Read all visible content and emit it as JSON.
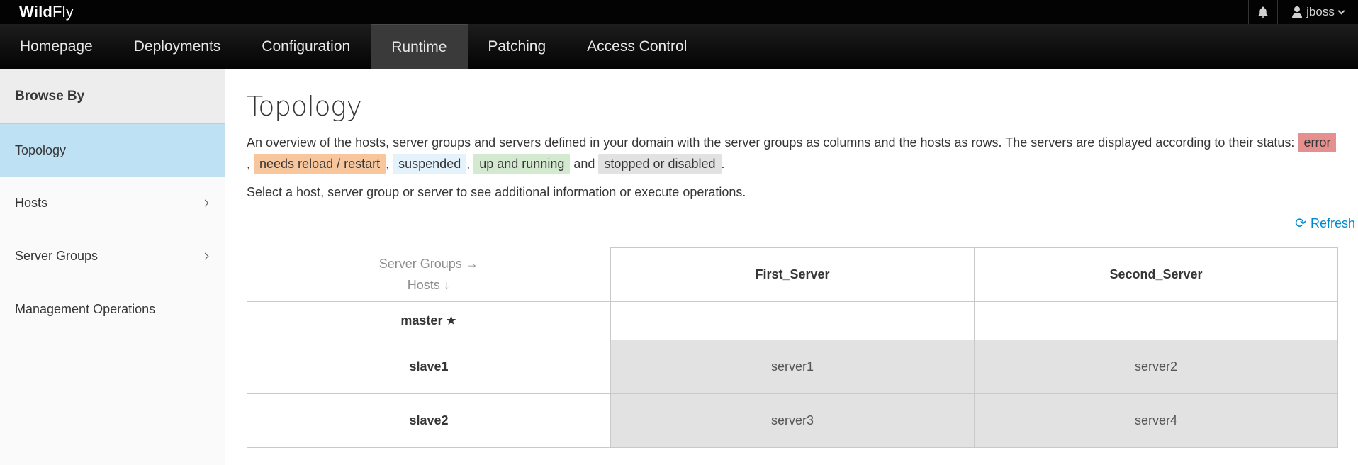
{
  "brand": {
    "bold": "Wild",
    "rest": "Fly"
  },
  "user": {
    "name": "jboss"
  },
  "nav": [
    "Homepage",
    "Deployments",
    "Configuration",
    "Runtime",
    "Patching",
    "Access Control"
  ],
  "nav_active": "Runtime",
  "sidebar": {
    "header": "Browse By",
    "items": [
      {
        "label": "Topology",
        "active": true
      },
      {
        "label": "Hosts"
      },
      {
        "label": "Server Groups"
      },
      {
        "label": "Management Operations"
      }
    ]
  },
  "page": {
    "title": "Topology",
    "desc_before": "An overview of the hosts, server groups and servers defined in your domain with the server groups as columns and the hosts as rows. The servers are displayed according to their status:",
    "status": {
      "error": "error",
      "reload": "needs reload / restart",
      "suspended": "suspended",
      "running": "up and running",
      "and": "and",
      "stopped": "stopped or disabled"
    },
    "hint": "Select a host, server group or server to see additional information or execute operations.",
    "refresh": "Refresh"
  },
  "table": {
    "corner_groups": "Server Groups →",
    "corner_hosts": "Hosts ↓",
    "groups": [
      "First_Server",
      "Second_Server"
    ],
    "hosts": [
      {
        "name": "master",
        "servers": [
          "",
          ""
        ]
      },
      {
        "name": "slave1",
        "servers": [
          "server1",
          "server2"
        ]
      },
      {
        "name": "slave2",
        "servers": [
          "server3",
          "server4"
        ]
      }
    ]
  },
  "colors": {
    "error": "#e58f8f",
    "reload": "#f7c69d",
    "suspended": "#e4f3fb",
    "running": "#d4ead0",
    "stopped": "#e2e2e2",
    "accent": "#0088ce",
    "active_nav": "#3a3a3a",
    "active_sidebar": "#bee1f4"
  },
  "icons": {
    "notifications": "bell-icon",
    "user": "user-icon",
    "refresh": "refresh-icon",
    "master": "star-icon"
  }
}
